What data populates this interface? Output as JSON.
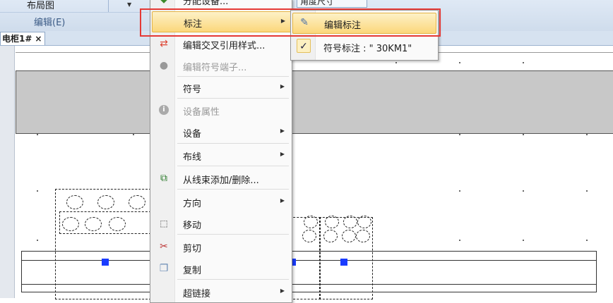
{
  "ribbon": {
    "layout_label": "布局图",
    "edit_group": "编辑(E)",
    "partial_menu_text": "分配设备...",
    "partial_button_text": "角度尺寸"
  },
  "document_tab": {
    "label": "电柜1#",
    "close": "×"
  },
  "context_menu": {
    "items": [
      {
        "label": "标注",
        "submenu": true,
        "disabled": false,
        "icon": "none",
        "hover": true
      },
      {
        "label": "编辑交叉引用样式...",
        "submenu": false,
        "disabled": false,
        "icon": "cross-ref-icon"
      },
      {
        "label": "编辑符号端子...",
        "submenu": false,
        "disabled": true,
        "icon": "sphere-icon"
      },
      {
        "label": "符号",
        "submenu": true,
        "disabled": false,
        "icon": "none"
      },
      {
        "label": "设备属性",
        "submenu": false,
        "disabled": true,
        "icon": "info-icon"
      },
      {
        "label": "设备",
        "submenu": true,
        "disabled": false,
        "icon": "none"
      },
      {
        "label": "布线",
        "submenu": true,
        "disabled": false,
        "icon": "none"
      },
      {
        "label": "从线束添加/删除...",
        "submenu": false,
        "disabled": false,
        "icon": "harness-icon"
      },
      {
        "label": "方向",
        "submenu": true,
        "disabled": false,
        "icon": "none"
      },
      {
        "label": "移动",
        "submenu": false,
        "disabled": false,
        "icon": "move-icon"
      },
      {
        "label": "剪切",
        "submenu": false,
        "disabled": false,
        "icon": "scissors-icon"
      },
      {
        "label": "复制",
        "submenu": false,
        "disabled": false,
        "icon": "copy-icon"
      },
      {
        "label": "超链接",
        "submenu": true,
        "disabled": false,
        "icon": "none"
      }
    ],
    "arrow_glyph": "▶"
  },
  "submenu": {
    "items": [
      {
        "label": "编辑标注",
        "icon": "edit-annotation-icon",
        "hover": true
      },
      {
        "label": "符号标注 : \" 30KM1\"",
        "icon": "check-icon",
        "checked": true
      }
    ]
  },
  "icons": {
    "check": "✓",
    "info": "i",
    "scissors": "✂"
  },
  "colors": {
    "highlight_border": "#e53935",
    "hover_fill": "#fbd77b",
    "terminal_blue": "#1a3cff"
  }
}
